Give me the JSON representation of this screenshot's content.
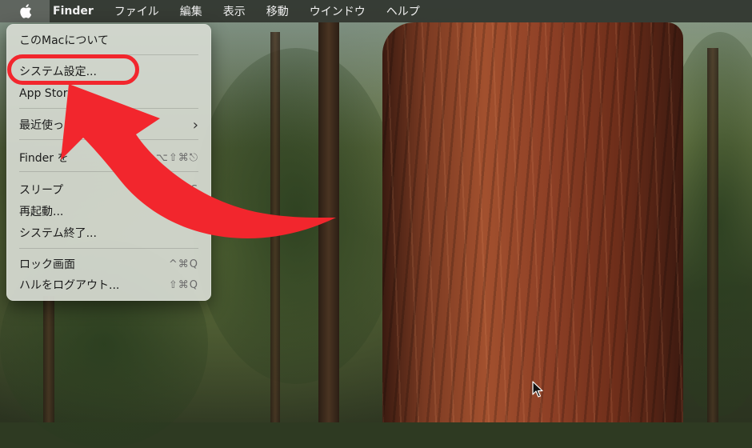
{
  "menubar": {
    "apple_icon": "apple-logo-icon",
    "app_name": "Finder",
    "items": [
      "ファイル",
      "編集",
      "表示",
      "移動",
      "ウインドウ",
      "ヘルプ"
    ]
  },
  "apple_menu": {
    "about": "このMacについて",
    "system_settings": "システム設定...",
    "app_store": "App Store",
    "recent": "最近使った",
    "force_quit": "Finder を",
    "force_quit_shortcut": "⌥⇧⌘⎋",
    "sleep": "スリープ",
    "sleep_shortcut": "⌘S",
    "restart": "再起動...",
    "shutdown": "システム終了...",
    "lock": "ロック画面",
    "lock_shortcut": "^⌘Q",
    "logout": "ハルをログアウト...",
    "logout_shortcut": "⇧⌘Q"
  },
  "annotation": {
    "color": "#f2262d"
  }
}
